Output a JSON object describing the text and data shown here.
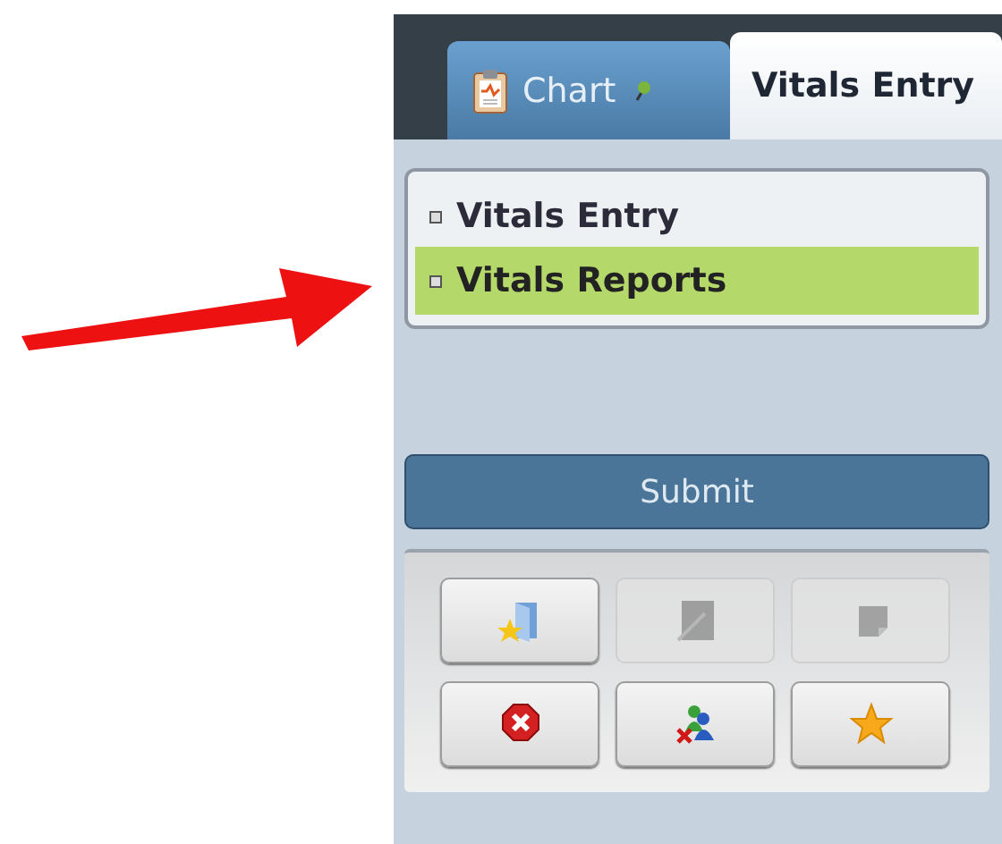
{
  "tabs": [
    {
      "label": "Chart",
      "selected": false
    },
    {
      "label": "Vitals Entry",
      "selected": true
    }
  ],
  "nav_items": [
    {
      "label": "Vitals Entry",
      "selected": false
    },
    {
      "label": "Vitals Reports",
      "selected": true
    }
  ],
  "submit_button": {
    "label": "Submit"
  },
  "tool_buttons": [
    {
      "disabled": false
    },
    {
      "disabled": true
    },
    {
      "disabled": true
    },
    {
      "disabled": false
    },
    {
      "disabled": false
    },
    {
      "disabled": false
    }
  ]
}
